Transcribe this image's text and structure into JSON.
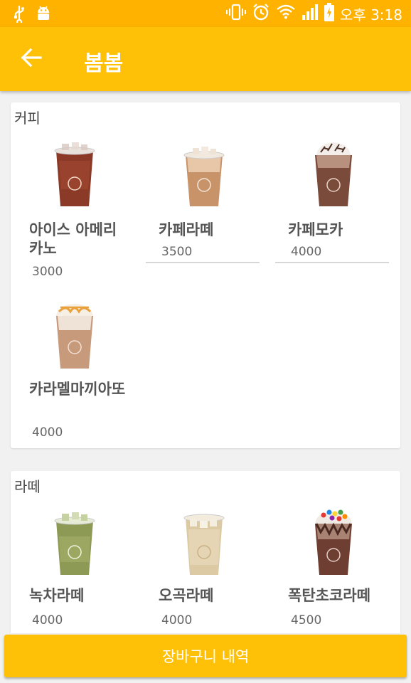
{
  "status_bar": {
    "time": "오후 3:18",
    "icons": [
      "usb-icon",
      "android-icon",
      "vibrate-icon",
      "alarm-icon",
      "wifi-icon",
      "signal-icon",
      "battery-charging-icon"
    ]
  },
  "app_bar": {
    "title": "봄봄",
    "back_icon": "arrow-left-icon"
  },
  "categories": [
    {
      "title": "커피",
      "items": [
        {
          "name": "아이스 아메리카노",
          "price": "3000",
          "drink": "americano"
        },
        {
          "name": "카페라떼",
          "price": "3500",
          "drink": "latte"
        },
        {
          "name": "카페모카",
          "price": "4000",
          "drink": "mocha"
        },
        {
          "name": "카라멜마끼아또",
          "price": "4000",
          "drink": "caramel"
        }
      ]
    },
    {
      "title": "라떼",
      "items": [
        {
          "name": "녹차라떼",
          "price": "4000",
          "drink": "greentea"
        },
        {
          "name": "오곡라떼",
          "price": "4000",
          "drink": "grain"
        },
        {
          "name": "폭탄초코라떼",
          "price": "4500",
          "drink": "choco"
        }
      ]
    }
  ],
  "cart_button": {
    "label": "장바구니 내역"
  },
  "colors": {
    "status_bar": "#FFB300",
    "app_bar": "#FFC107",
    "accent": "#FFC107"
  }
}
